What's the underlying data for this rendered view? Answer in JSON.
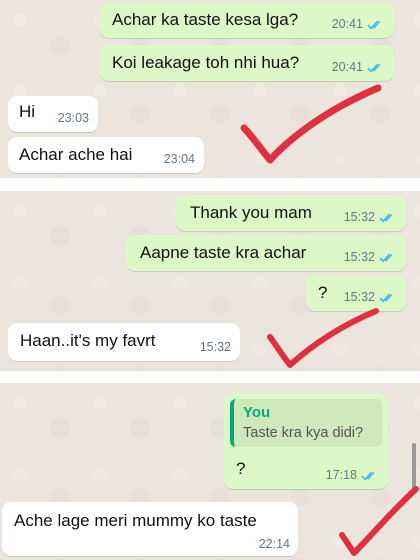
{
  "panel1": {
    "messages": [
      {
        "text": "Achar ka taste kesa lga?",
        "time": "20:41",
        "direction": "outgoing",
        "status": "read"
      },
      {
        "text": "Koi leakage toh nhi hua?",
        "time": "20:41",
        "direction": "outgoing",
        "status": "read"
      },
      {
        "text": "Hi",
        "time": "23:03",
        "direction": "incoming"
      },
      {
        "text": "Achar ache hai",
        "time": "23:04",
        "direction": "incoming"
      }
    ]
  },
  "panel2": {
    "messages": [
      {
        "text": "Thank you mam",
        "time": "15:32",
        "direction": "outgoing",
        "status": "read"
      },
      {
        "text": "Aapne taste kra achar",
        "time": "15:32",
        "direction": "outgoing",
        "status": "read"
      },
      {
        "text": "?",
        "time": "15:32",
        "direction": "outgoing",
        "status": "read"
      },
      {
        "text": "Haan..it's my favrt",
        "time": "15:32",
        "direction": "incoming"
      }
    ]
  },
  "panel3": {
    "reply": {
      "quote_author": "You",
      "quote_text": "Taste kra kya didi?",
      "text": "?",
      "time": "17:18",
      "direction": "outgoing",
      "status": "read"
    },
    "messages": [
      {
        "text": "Ache lage meri mummy ko taste",
        "time": "22:14",
        "direction": "incoming"
      }
    ]
  },
  "colors": {
    "outgoing_bubble": "#dcf8c6",
    "incoming_bubble": "#ffffff",
    "read_tick": "#34b7f1",
    "annotation_check": "#e0303f",
    "quote_accent": "#06a884"
  },
  "icons": [
    "double-check-read-icon",
    "red-checkmark-annotation"
  ]
}
